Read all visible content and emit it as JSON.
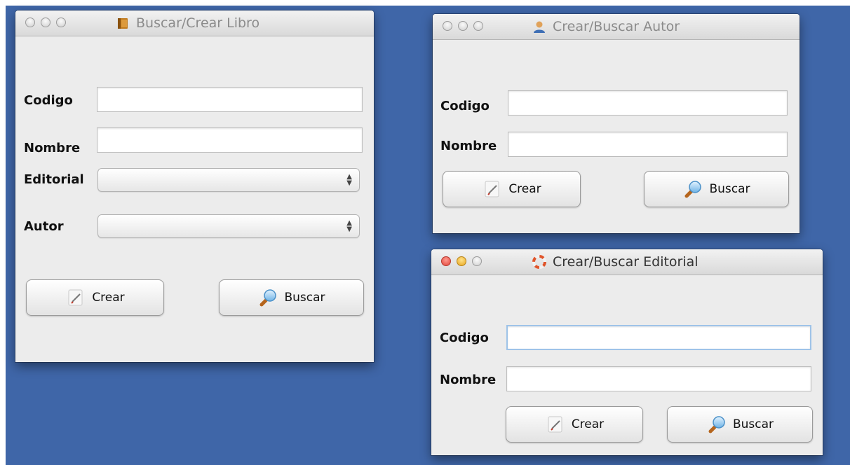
{
  "windows": {
    "libro": {
      "title": "Buscar/Crear Libro",
      "icon": "book-icon",
      "fields": {
        "codigo_label": "Codigo",
        "nombre_label": "Nombre",
        "editorial_label": "Editorial",
        "autor_label": "Autor",
        "codigo_value": "",
        "nombre_value": "",
        "editorial_selected": "",
        "autor_selected": ""
      },
      "buttons": {
        "crear": "Crear",
        "buscar": "Buscar"
      }
    },
    "autor": {
      "title": "Crear/Buscar Autor",
      "icon": "person-icon",
      "fields": {
        "codigo_label": "Codigo",
        "nombre_label": "Nombre",
        "codigo_value": "",
        "nombre_value": ""
      },
      "buttons": {
        "crear": "Crear",
        "buscar": "Buscar"
      }
    },
    "editorial": {
      "title": "Crear/Buscar Editorial",
      "icon": "lifebuoy-icon",
      "active": true,
      "fields": {
        "codigo_label": "Codigo",
        "nombre_label": "Nombre",
        "codigo_value": "",
        "nombre_value": ""
      },
      "buttons": {
        "crear": "Crear",
        "buscar": "Buscar"
      }
    }
  },
  "colors": {
    "desktop": "#3f66a8",
    "close_active": "#e0443a",
    "minimize_active": "#e8a61d"
  }
}
